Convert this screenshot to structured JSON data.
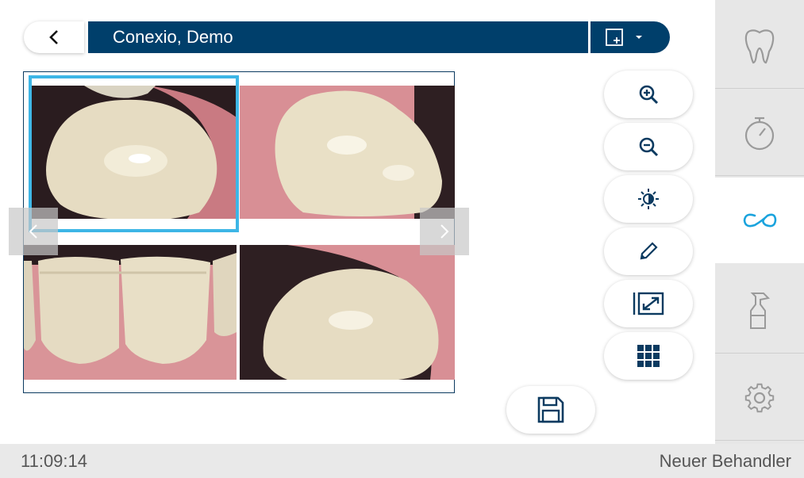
{
  "header": {
    "back_icon": "chevron-left-icon",
    "patient_name": "Conexio, Demo",
    "view_icon": "add-layout-icon",
    "view_dropdown_icon": "caret-down-icon"
  },
  "colors": {
    "primary": "#003f6b",
    "selection": "#3db6e6",
    "active_accent": "#1aa3dd",
    "sidebar_bg": "#e7e7e7",
    "status_bg": "#e9e9e9"
  },
  "image_grid": {
    "layout": "2x2",
    "selected_index": 0,
    "images": [
      {
        "name": "tooth-image-1"
      },
      {
        "name": "tooth-image-2"
      },
      {
        "name": "tooth-image-3"
      },
      {
        "name": "tooth-image-4"
      }
    ],
    "nav_prev_icon": "chevron-left-icon",
    "nav_next_icon": "chevron-right-icon"
  },
  "tools": [
    {
      "name": "zoom-in-button",
      "icon": "zoom-in-icon"
    },
    {
      "name": "zoom-out-button",
      "icon": "zoom-out-icon"
    },
    {
      "name": "brightness-contrast-button",
      "icon": "brightness-contrast-icon"
    },
    {
      "name": "annotate-button",
      "icon": "pencil-icon"
    },
    {
      "name": "fit-screen-button",
      "icon": "expand-icon"
    },
    {
      "name": "grid-view-button",
      "icon": "grid-icon"
    }
  ],
  "save": {
    "icon": "save-icon"
  },
  "sidebar": {
    "items": [
      {
        "name": "tooth-icon",
        "active": false
      },
      {
        "name": "timer-icon",
        "active": false
      },
      {
        "name": "connect-icon",
        "active": true
      },
      {
        "name": "spray-bottle-icon",
        "active": false
      },
      {
        "name": "gear-icon",
        "active": false
      }
    ]
  },
  "status_bar": {
    "time": "11:09:14",
    "user": "Neuer Behandler"
  }
}
